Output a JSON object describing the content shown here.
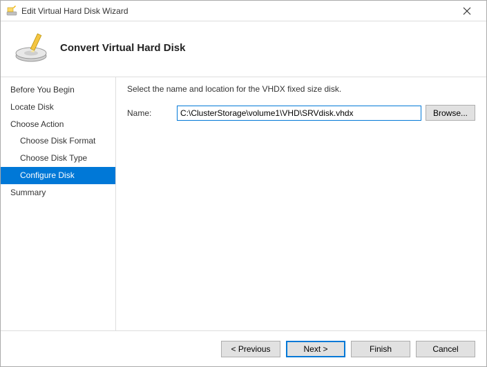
{
  "window": {
    "title": "Edit Virtual Hard Disk Wizard"
  },
  "header": {
    "title": "Convert Virtual Hard Disk"
  },
  "sidebar": {
    "items": [
      {
        "label": "Before You Begin",
        "sub": false,
        "selected": false
      },
      {
        "label": "Locate Disk",
        "sub": false,
        "selected": false
      },
      {
        "label": "Choose Action",
        "sub": false,
        "selected": false
      },
      {
        "label": "Choose Disk Format",
        "sub": true,
        "selected": false
      },
      {
        "label": "Choose Disk Type",
        "sub": true,
        "selected": false
      },
      {
        "label": "Configure Disk",
        "sub": true,
        "selected": true
      },
      {
        "label": "Summary",
        "sub": false,
        "selected": false
      }
    ]
  },
  "main": {
    "instruction": "Select the name and location for the VHDX fixed size disk.",
    "name_label": "Name:",
    "name_value": "C:\\ClusterStorage\\volume1\\VHD\\SRVdisk.vhdx",
    "browse_label": "Browse..."
  },
  "footer": {
    "previous": "< Previous",
    "next": "Next >",
    "finish": "Finish",
    "cancel": "Cancel"
  }
}
